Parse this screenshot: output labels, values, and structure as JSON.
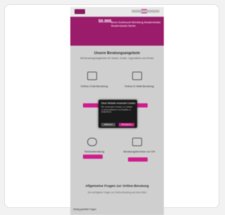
{
  "page": {
    "hero": {
      "left_text": "",
      "headline": "50.000",
      "subline": "Bonn Dortmund Nürnberg Musterstraße Musterstraße Berlin"
    },
    "section_title": "Unsere Beratungsangebote",
    "section_subtitle": "Mit Beratungsangeboten für Nutzer, Kinder, Jugendliche und Kinder",
    "tiles": [
      {
        "label": "Online-Chat-Beratung",
        "icon": "chat-bubble-icon"
      },
      {
        "label": "Online-E-Mail-Beratung",
        "icon": "mail-icon"
      },
      {
        "label": "Telefonberatung",
        "icon": "phone-icon"
      },
      {
        "label": "Beratungstermine vor Ort",
        "icon": "calendar-icon"
      }
    ],
    "overlay": {
      "title": "Diese Website verwendet Cookies",
      "text": "Wir verwenden Cookies, um Inhalte zu personalisieren und Zugriffe zu analysieren.",
      "deny": "Ablehnen",
      "accept": "Akzeptieren"
    },
    "faq_title": "Allgemeine Fragen zur Online-Beratung",
    "faq_sub": "Die wichtigsten Fragen zur Online-Beratung auf einen Blick",
    "footer_left": "Häufig gestellte Fragen"
  }
}
